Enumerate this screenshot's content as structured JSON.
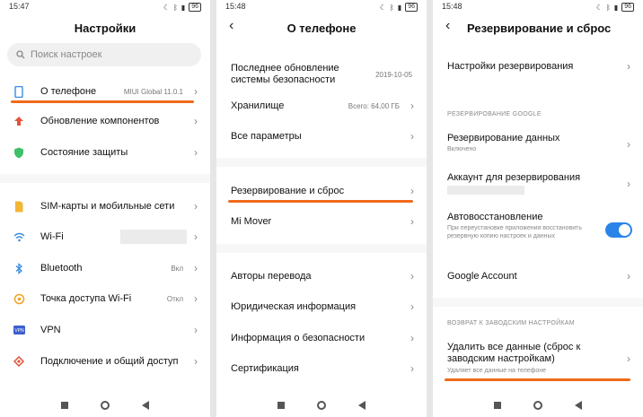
{
  "screen1": {
    "status": {
      "time": "15:47",
      "battery": "96"
    },
    "title": "Настройки",
    "search": {
      "placeholder": "Поиск настроек"
    },
    "items": [
      {
        "label": "О телефоне",
        "value": "MIUI Global 11.0.1",
        "icon": "phone-info-icon",
        "color": "#3a8de0"
      },
      {
        "label": "Обновление компонентов",
        "value": "",
        "icon": "update-arrow-icon",
        "color": "#e2543b"
      },
      {
        "label": "Состояние защиты",
        "value": "",
        "icon": "shield-icon",
        "color": "#3fbf6a"
      },
      {
        "label": "SIM-карты и мобильные сети",
        "value": "",
        "icon": "sim-card-icon",
        "color": "#f2b634"
      },
      {
        "label": "Wi-Fi",
        "value": "",
        "icon": "wifi-icon",
        "color": "#3a8de0"
      },
      {
        "label": "Bluetooth",
        "value": "Вкл",
        "icon": "bluetooth-icon",
        "color": "#3a8de0"
      },
      {
        "label": "Точка доступа Wi-Fi",
        "value": "Откл",
        "icon": "hotspot-icon",
        "color": "#f2a024"
      },
      {
        "label": "VPN",
        "value": "",
        "icon": "vpn-icon",
        "color": "#3c5fcf"
      },
      {
        "label": "Подключение и общий доступ",
        "value": "",
        "icon": "connection-icon",
        "color": "#e2543b"
      }
    ]
  },
  "screen2": {
    "status": {
      "time": "15:48",
      "battery": "96"
    },
    "title": "О телефоне",
    "items": [
      {
        "label": "Последнее обновление системы безопасности",
        "value": "2019-10-05"
      },
      {
        "label": "Хранилище",
        "value": "Всего: 64,00 ГБ"
      },
      {
        "label": "Все параметры",
        "value": ""
      },
      {
        "label": "Резервирование и сброс",
        "value": ""
      },
      {
        "label": "Mi Mover",
        "value": ""
      },
      {
        "label": "Авторы перевода",
        "value": ""
      },
      {
        "label": "Юридическая информация",
        "value": ""
      },
      {
        "label": "Информация о безопасности",
        "value": ""
      },
      {
        "label": "Сертификация",
        "value": ""
      }
    ]
  },
  "screen3": {
    "status": {
      "time": "15:48",
      "battery": "96"
    },
    "title": "Резервирование и сброс",
    "backup_settings": "Настройки резервирования",
    "section_google": "РЕЗЕРВИРОВАНИЕ GOOGLE",
    "data_backup": {
      "label": "Резервирование данных",
      "sub": "Включено"
    },
    "backup_account": "Аккаунт для резервирования",
    "auto_restore": {
      "label": "Автовосстановление",
      "sub": "При переустановке приложения восстановить резервную копию настроек и данных",
      "enabled": true
    },
    "google_account": "Google Account",
    "section_reset": "ВОЗВРАТ К ЗАВОДСКИМ НАСТРОЙКАМ",
    "factory_reset": {
      "label": "Удалить все данные (сброс к заводским настройкам)",
      "sub": "Удаляет все данные на телефоне"
    }
  },
  "colors": {
    "accent": "#f06a1b",
    "toggle": "#2a84e8"
  }
}
